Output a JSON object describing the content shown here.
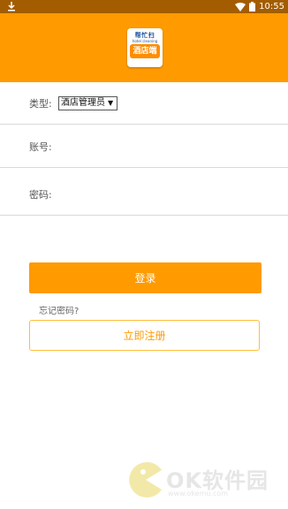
{
  "status_bar": {
    "time": "10:55",
    "icons": [
      "download-icon",
      "wifi-icon",
      "battery-icon"
    ]
  },
  "header": {
    "logo_text_top": "帮忙扫",
    "logo_text_sub": "hotel cleaning",
    "logo_badge": "酒店端"
  },
  "form": {
    "type_label": "类型:",
    "type_selected": "酒店管理员",
    "account_label": "账号:",
    "account_value": "",
    "password_label": "密码:",
    "password_value": ""
  },
  "buttons": {
    "login": "登录",
    "forgot": "忘记密码?",
    "register": "立即注册"
  },
  "watermark": {
    "text": "OK软件园",
    "url": "www.okemu.com"
  },
  "colors": {
    "primary": "#ff9a00",
    "status_bar": "#a35d00",
    "register_border": "#ffbe3a"
  }
}
